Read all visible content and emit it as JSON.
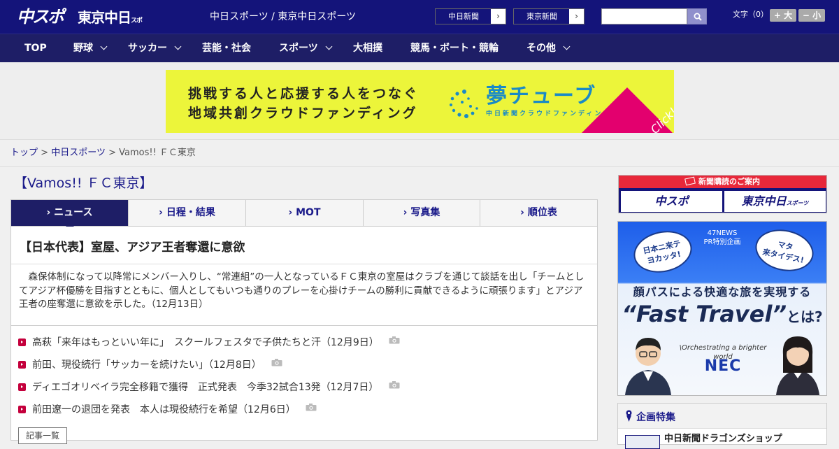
{
  "header": {
    "logo_main": "中スポ",
    "logo_sub": "東京中日",
    "logo_sub_small": "スポーツ",
    "site_title": "中日スポーツ / 東京中日スポーツ",
    "external_links": [
      {
        "label": "中日新聞",
        "arrow": "›"
      },
      {
        "label": "東京新聞",
        "arrow": "›"
      }
    ],
    "search": {
      "placeholder": "",
      "value": ""
    },
    "font_size_label": "文字（0）",
    "font_larger": "+ 大",
    "font_smaller": "− 小"
  },
  "nav": {
    "items": [
      {
        "label": "TOP",
        "has_dropdown": false
      },
      {
        "label": "野球",
        "has_dropdown": true
      },
      {
        "label": "サッカー",
        "has_dropdown": true
      },
      {
        "label": "芸能・社会",
        "has_dropdown": false
      },
      {
        "label": "スポーツ",
        "has_dropdown": true
      },
      {
        "label": "大相撲",
        "has_dropdown": false
      },
      {
        "label": "競馬・ボート・競輪",
        "has_dropdown": false
      },
      {
        "label": "その他",
        "has_dropdown": true
      }
    ]
  },
  "banner_ad": {
    "line1": "挑戦する人と応援する人をつなぐ",
    "line2": "地域共創クラウドファンディング",
    "brand": "夢チューブ",
    "brand_sub": "中日新聞クラウドファンディング",
    "click": "Click!"
  },
  "breadcrumb": {
    "items": [
      "トップ",
      "中日スポーツ",
      "Vamos!! ＦＣ東京"
    ],
    "separator": ">"
  },
  "page": {
    "title": "【Vamos!! ＦＣ東京】",
    "tabs": [
      {
        "label": "ニュース",
        "active": true
      },
      {
        "label": "日程・結果",
        "active": false
      },
      {
        "label": "MOT",
        "active": false
      },
      {
        "label": "写真集",
        "active": false
      },
      {
        "label": "順位表",
        "active": false
      }
    ],
    "tab_marker": "›"
  },
  "article": {
    "title": "【日本代表】室屋、アジア王者奪還に意欲",
    "body": "　森保体制になって以降常にメンバー入りし、“常連組”の一人となっているＦＣ東京の室屋はクラブを通じて談話を出し「チームとしてアジア杯優勝を目指すとともに、個人としてもいつも通りのプレーを心掛けチームの勝利に貢献できるように頑張ります」とアジア王者の座奪還に意欲を示した。（12月13日）"
  },
  "related": [
    {
      "text": "高萩「来年はもっといい年に」　スクールフェスタで子供たちと汗（12月9日）",
      "has_photo": true
    },
    {
      "text": "前田、現役続行「サッカーを続けたい」（12月8日）",
      "has_photo": true
    },
    {
      "text": "ディエゴオリベイラ完全移籍で獲得　正式発表　今季32試合13発（12月7日）",
      "has_photo": true
    },
    {
      "text": "前田遼一の退団を発表　本人は現役続行を希望（12月6日）",
      "has_photo": true
    }
  ],
  "more_button": "記事一覧",
  "sidebar": {
    "subscribe_heading": "新聞購読のご案内",
    "subscribe_links": [
      "中スポ",
      "東京中日"
    ],
    "subscribe_link_small": "スポーツ",
    "nec_ad": {
      "bubble_left": "日本ニ来テ\nヨカッタ!",
      "pr_line1": "47NEWS",
      "pr_line2": "PR特別企画",
      "bubble_right": "マタ\n来タイデス!",
      "subtitle": "顔パスによる快適な旅を実現する",
      "headline": "“Fast Travel”",
      "headline_tail": "とは?",
      "tagline": "\\Orchestrating a brighter world",
      "brand": "NEC"
    },
    "feature_heading": "企画特集",
    "feature_item": "中日新聞ドラゴンズショップ"
  },
  "colors": {
    "header_bg": "#14147a",
    "nav_bg": "#1e1e66",
    "link": "#1a1a8a",
    "marker_red": "#c4003c",
    "banner_yellow": "#ecf53a",
    "banner_pink": "#e3006e"
  }
}
